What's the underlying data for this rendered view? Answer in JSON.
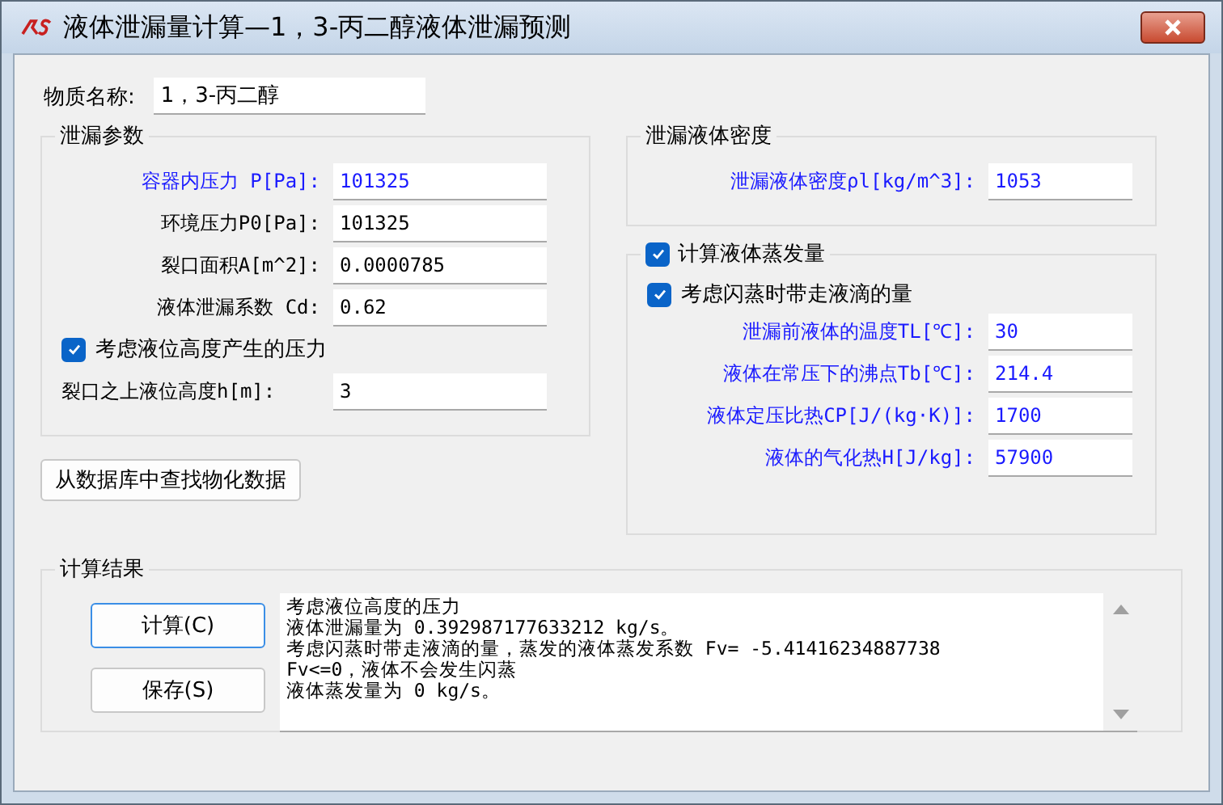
{
  "window": {
    "title": "液体泄漏量计算—1，3-丙二醇液体泄漏预测"
  },
  "substance": {
    "label": "物质名称:",
    "value": "1，3-丙二醇"
  },
  "leak_params": {
    "title": "泄漏参数",
    "fields": [
      {
        "label": "容器内压力 P[Pa]:",
        "value": "101325",
        "color": "#1a1aff"
      },
      {
        "label": "环境压力P0[Pa]:",
        "value": "101325",
        "color": "#000000"
      },
      {
        "label": "裂口面积A[m^2]:",
        "value": "0.0000785",
        "color": "#000000"
      },
      {
        "label": "液体泄漏系数  Cd:",
        "value": "0.62",
        "color": "#000000"
      }
    ],
    "level_option": {
      "label": "考虑液位高度产生的压力",
      "checked": true
    },
    "height_field": {
      "label": "裂口之上液位高度h[m]:",
      "value": "3"
    }
  },
  "lookup_button": "从数据库中查找物化数据",
  "density": {
    "title": "泄漏液体密度",
    "fields": [
      {
        "label": "泄漏液体密度ρl[kg/m^3]:",
        "value": "1053",
        "color": "#1a1aff"
      }
    ]
  },
  "evaporation": {
    "label": "计算液体蒸发量",
    "checked": true,
    "flash_option": {
      "label": "考虑闪蒸时带走液滴的量",
      "checked": true
    },
    "fields": [
      {
        "label": "泄漏前液体的温度TL[℃]:",
        "value": "30",
        "color": "#1a1aff"
      },
      {
        "label": "液体在常压下的沸点Tb[℃]:",
        "value": "214.4",
        "color": "#1a1aff"
      },
      {
        "label": "液体定压比热CP[J/(kg·K)]:",
        "value": "1700",
        "color": "#1a1aff"
      },
      {
        "label": "液体的气化热H[J/kg]:",
        "value": "57900",
        "color": "#1a1aff"
      }
    ]
  },
  "results": {
    "title": "计算结果",
    "buttons": [
      {
        "label": "计算(C)",
        "focused": true
      },
      {
        "label": "保存(S)",
        "focused": false
      }
    ],
    "output_lines": [
      "考虑液位高度的压力",
      "液体泄漏量为 0.392987177633212 kg/s。",
      "考虑闪蒸时带走液滴的量，蒸发的液体蒸发系数 Fv= -5.41416234887738",
      "Fv<=0，液体不会发生闪蒸",
      "液体蒸发量为 0 kg/s。"
    ]
  }
}
